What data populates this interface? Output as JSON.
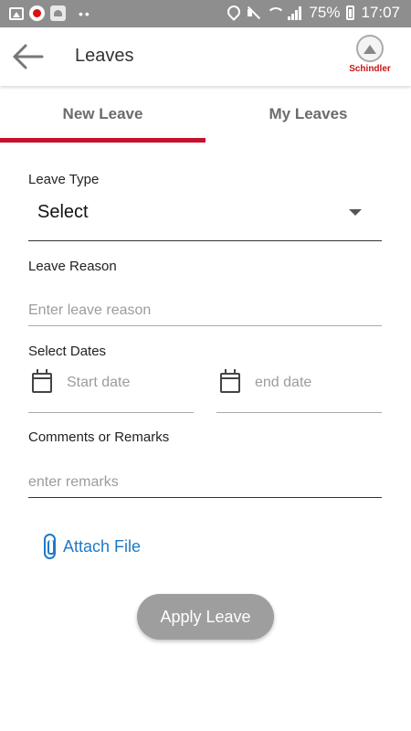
{
  "status_bar": {
    "battery": "75%",
    "time": "17:07",
    "icons": [
      "gallery-icon",
      "notification-app-icon",
      "android-icon",
      "more-dots-icon",
      "location-icon",
      "mute-icon",
      "wifi-icon",
      "signal-icon",
      "battery-charging-icon"
    ]
  },
  "app_bar": {
    "title": "Leaves",
    "logo_text": "Schindler",
    "back_icon": "arrow-back-icon"
  },
  "tabs": [
    {
      "label": "New Leave",
      "active": true
    },
    {
      "label": "My Leaves",
      "active": false
    }
  ],
  "form": {
    "leave_type_label": "Leave Type",
    "leave_type_value": "Select",
    "leave_reason_label": "Leave Reason",
    "leave_reason_placeholder": "Enter leave reason",
    "select_dates_label": "Select Dates",
    "start_date_placeholder": "Start date",
    "end_date_placeholder": "end date",
    "comments_label": "Comments or Remarks",
    "remarks_placeholder": "enter remarks",
    "attach_label": "Attach File",
    "apply_label": "Apply Leave"
  },
  "colors": {
    "status_bar": "#8e8e8e",
    "tab_indicator": "#c8102e",
    "link": "#1e7ac6",
    "button": "#9e9e9e",
    "brand": "#cc1111"
  }
}
